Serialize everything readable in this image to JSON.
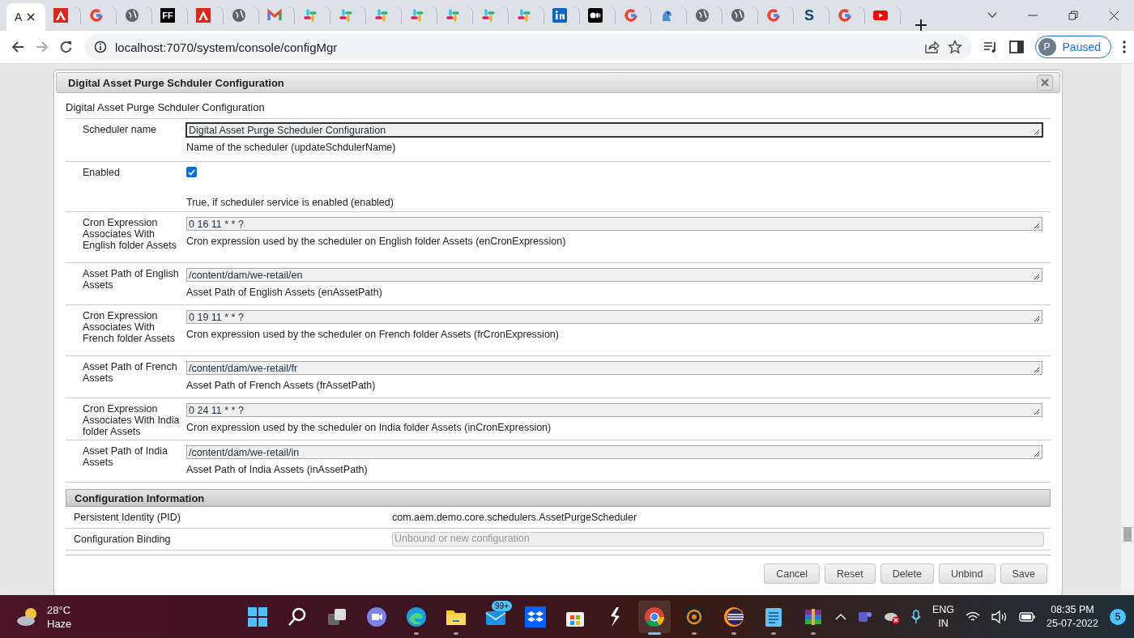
{
  "browser": {
    "tabs": [
      {
        "kind": "adobe-text",
        "label": "A",
        "selected": true
      },
      {
        "kind": "adobe",
        "selected": false
      },
      {
        "kind": "google",
        "selected": false
      },
      {
        "kind": "globe",
        "selected": false
      },
      {
        "kind": "badge",
        "glyph": "FF",
        "selected": false
      },
      {
        "kind": "adobe",
        "selected": false
      },
      {
        "kind": "globe",
        "selected": false
      },
      {
        "kind": "gmail",
        "selected": false
      },
      {
        "kind": "slack",
        "selected": false
      },
      {
        "kind": "slack",
        "selected": false
      },
      {
        "kind": "slack",
        "selected": false
      },
      {
        "kind": "slack",
        "selected": false
      },
      {
        "kind": "slack",
        "selected": false
      },
      {
        "kind": "slack",
        "selected": false
      },
      {
        "kind": "slack",
        "selected": false
      },
      {
        "kind": "linkedin",
        "selected": false
      },
      {
        "kind": "medium",
        "selected": false
      },
      {
        "kind": "google",
        "selected": false
      },
      {
        "kind": "bird",
        "selected": false
      },
      {
        "kind": "globe",
        "selected": false
      },
      {
        "kind": "globe",
        "selected": false
      },
      {
        "kind": "google",
        "selected": false
      },
      {
        "kind": "letter",
        "glyph": "S",
        "selected": false
      },
      {
        "kind": "google",
        "selected": false
      },
      {
        "kind": "youtube",
        "selected": false
      }
    ],
    "address": "localhost:7070/system/console/configMgr",
    "profile_initial": "P",
    "profile_status": "Paused"
  },
  "dialog": {
    "title": "Digital Asset Purge Schduler Configuration",
    "subtitle": "Digital Asset Purge Schduler Configuration",
    "fields": [
      {
        "kind": "text",
        "label": "Scheduler name",
        "value": "Digital Asset Purge Scheduler Configuration",
        "focused": true,
        "description": "Name of the scheduler (updateSchdulerName)"
      },
      {
        "kind": "checkbox",
        "label": "Enabled",
        "checked": true,
        "description": "True, if scheduler service is enabled (enabled)"
      },
      {
        "kind": "text",
        "label": "Cron Expression Associates With English folder Assets",
        "value": "0 16 11 * * ?",
        "focused": false,
        "description": "Cron expression used by the scheduler on English folder Assets (enCronExpression)"
      },
      {
        "kind": "text",
        "label": "Asset Path of English Assets",
        "value": "/content/dam/we-retail/en",
        "focused": false,
        "description": "Asset Path of English Assets (enAssetPath)"
      },
      {
        "kind": "text",
        "label": "Cron Expression Associates With French folder Assets",
        "value": "0 19 11 * * ?",
        "focused": false,
        "description": "Cron expression used by the scheduler on French folder Assets (frCronExpression)"
      },
      {
        "kind": "text",
        "label": "Asset Path of French Assets",
        "value": "/content/dam/we-retail/fr",
        "focused": false,
        "description": "Asset Path of French Assets (frAssetPath)"
      },
      {
        "kind": "text",
        "label": "Cron Expression Associates With India folder Assets",
        "value": "0 24 11 * * ?",
        "focused": false,
        "description": "Cron expression used by the scheduler on India folder Assets (inCronExpression)"
      },
      {
        "kind": "text",
        "label": "Asset Path of India Assets",
        "value": "/content/dam/we-retail/in",
        "focused": false,
        "description": "Asset Path of India Assets (inAssetPath)"
      }
    ],
    "info": {
      "title": "Configuration Information",
      "rows": [
        {
          "kind": "text",
          "label": "Persistent Identity (PID)",
          "value": "com.aem.demo.core.schedulers.AssetPurgeScheduler"
        },
        {
          "kind": "select",
          "label": "Configuration Binding",
          "placeholder": "Unbound or new configuration"
        }
      ]
    },
    "buttons": [
      "Cancel",
      "Reset",
      "Delete",
      "Unbind",
      "Save"
    ]
  },
  "taskbar": {
    "temperature": "28°C",
    "weather": "Haze",
    "apps": [
      {
        "kind": "start",
        "active": false
      },
      {
        "kind": "search",
        "active": false
      },
      {
        "kind": "taskview",
        "active": false
      },
      {
        "kind": "meet",
        "active": false
      },
      {
        "kind": "edge",
        "active": false
      },
      {
        "kind": "folder",
        "active": false
      },
      {
        "kind": "mail",
        "badge": "99+",
        "active": false
      },
      {
        "kind": "dropbox",
        "active": false
      },
      {
        "kind": "store",
        "active": false
      },
      {
        "kind": "bolt",
        "active": false
      },
      {
        "kind": "chrome",
        "active": true
      },
      {
        "kind": "gear",
        "active": false
      },
      {
        "kind": "eclipse",
        "active": false
      },
      {
        "kind": "notepad",
        "active": false
      },
      {
        "kind": "archive",
        "active": false
      }
    ],
    "language": "ENG",
    "region": "IN",
    "time": "08:35 PM",
    "date": "25-07-2022",
    "notifications": "5"
  }
}
